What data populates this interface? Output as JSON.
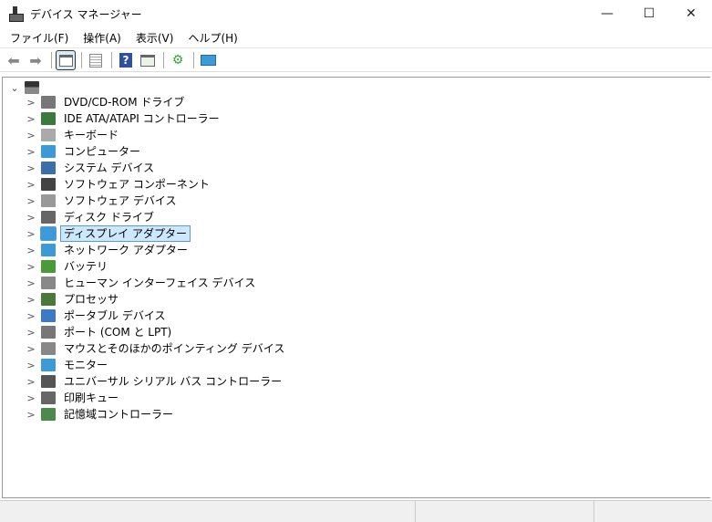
{
  "window": {
    "title": "デバイス マネージャー",
    "minimize": "—",
    "maximize": "☐",
    "close": "✕"
  },
  "menu": [
    "ファイル(F)",
    "操作(A)",
    "表示(V)",
    "ヘルプ(H)"
  ],
  "tree": {
    "items": [
      {
        "label": "DVD/CD-ROM ドライブ",
        "color": "#777"
      },
      {
        "label": "IDE ATA/ATAPI コントローラー",
        "color": "#3a7a3a"
      },
      {
        "label": "キーボード",
        "color": "#aaa"
      },
      {
        "label": "コンピューター",
        "color": "#3c9ad8"
      },
      {
        "label": "システム デバイス",
        "color": "#3a6fa8"
      },
      {
        "label": "ソフトウェア コンポーネント",
        "color": "#444"
      },
      {
        "label": "ソフトウェア デバイス",
        "color": "#999"
      },
      {
        "label": "ディスク ドライブ",
        "color": "#666"
      },
      {
        "label": "ディスプレイ アダプター",
        "color": "#3c9ad8",
        "selected": true
      },
      {
        "label": "ネットワーク アダプター",
        "color": "#3c9ad8"
      },
      {
        "label": "バッテリ",
        "color": "#4a9a3a"
      },
      {
        "label": "ヒューマン インターフェイス デバイス",
        "color": "#888"
      },
      {
        "label": "プロセッサ",
        "color": "#4a7a3a"
      },
      {
        "label": "ポータブル デバイス",
        "color": "#3a7ac8"
      },
      {
        "label": "ポート (COM と LPT)",
        "color": "#777"
      },
      {
        "label": "マウスとそのほかのポインティング デバイス",
        "color": "#888"
      },
      {
        "label": "モニター",
        "color": "#3c9ad8"
      },
      {
        "label": "ユニバーサル シリアル バス コントローラー",
        "color": "#555"
      },
      {
        "label": "印刷キュー",
        "color": "#666"
      },
      {
        "label": "記憶域コントローラー",
        "color": "#4a8a4a"
      }
    ]
  }
}
